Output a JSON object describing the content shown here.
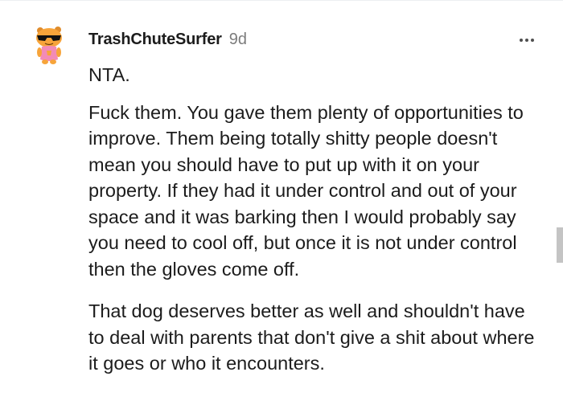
{
  "comment": {
    "username": "TrashChuteSurfer",
    "timestamp": "9d",
    "paragraphs": [
      "NTA.",
      "Fuck them. You gave them plenty of opportunities to improve. Them being totally shitty people doesn't mean you should have to put up with it on your property. If they had it under control and out of your space and it was barking then I would probably say you need to cool off, but once it is not under control then the gloves come off.",
      "That dog deserves better as well and shouldn't have to deal with parents that don't give a shit about where it goes or who it encounters."
    ]
  },
  "icons": {
    "avatar": "snoo-avatar-with-sunglasses",
    "more": "more-options-icon"
  },
  "colors": {
    "text": "#1c1c1c",
    "muted": "#7c7c7c",
    "avatar_body": "#f7a43a",
    "avatar_shirt": "#f38bb6",
    "scrollbar": "#c4c4c4"
  }
}
